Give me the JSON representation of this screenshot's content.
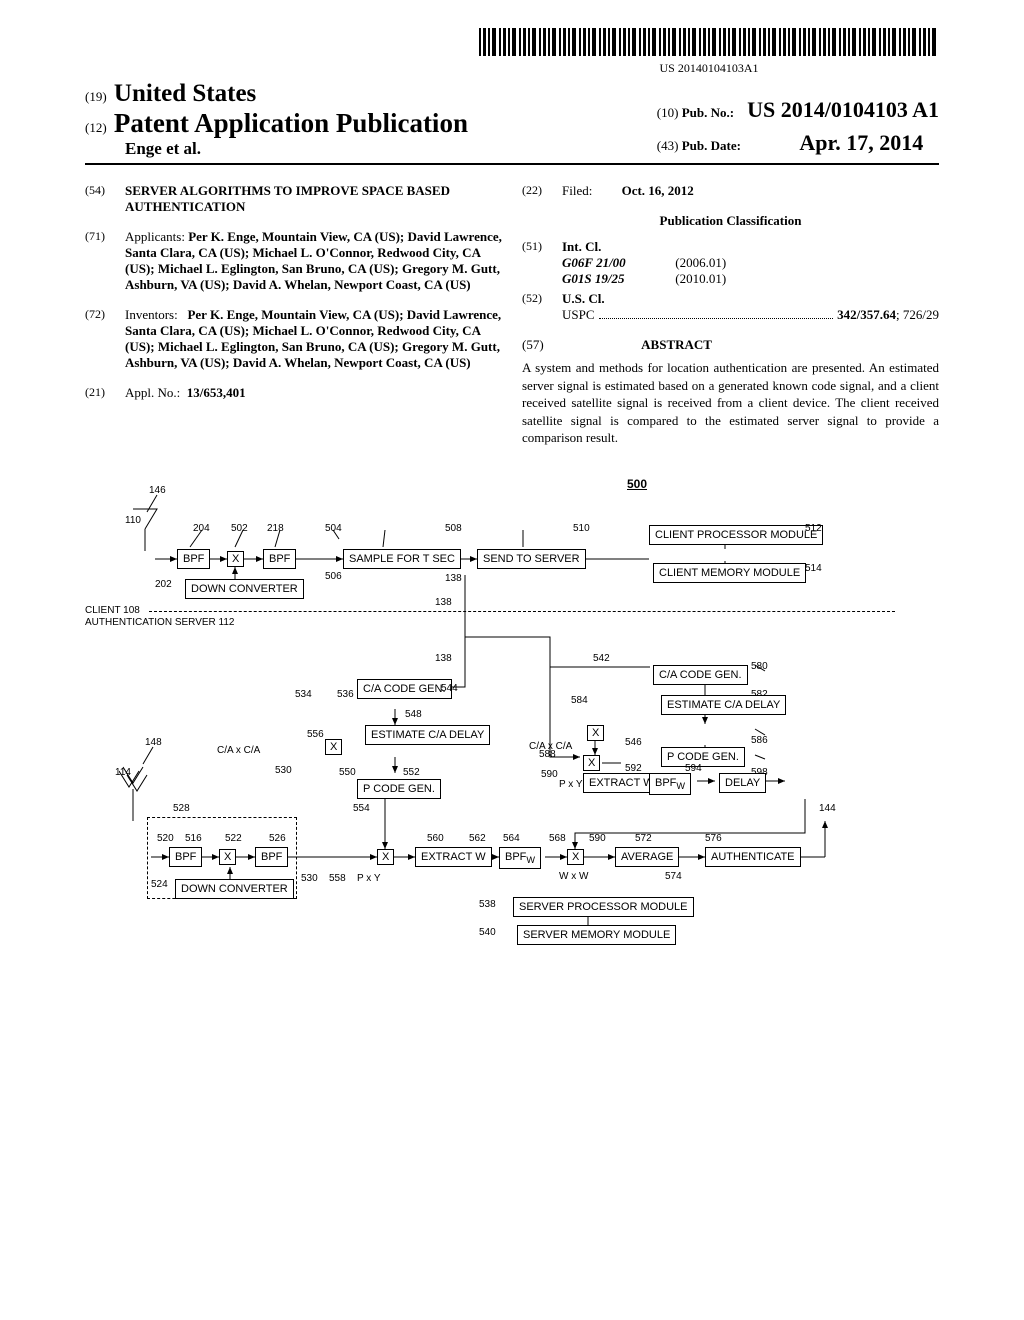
{
  "barcode_text": "US 20140104103A1",
  "header": {
    "code19": "(19)",
    "country": "United States",
    "code12": "(12)",
    "pubtype": "Patent Application Publication",
    "authors_line": "Enge et al.",
    "code10": "(10)",
    "pubno_label": "Pub. No.:",
    "pubno": "US 2014/0104103 A1",
    "code43": "(43)",
    "pubdate_label": "Pub. Date:",
    "pubdate": "Apr. 17, 2014"
  },
  "left": {
    "title_code": "(54)",
    "title": "SERVER ALGORITHMS TO IMPROVE SPACE BASED AUTHENTICATION",
    "applicants_code": "(71)",
    "applicants_label": "Applicants:",
    "applicants": "Per K. Enge, Mountain View, CA (US); David Lawrence, Santa Clara, CA (US); Michael L. O'Connor, Redwood City, CA (US); Michael L. Eglington, San Bruno, CA (US); Gregory M. Gutt, Ashburn, VA (US); David A. Whelan, Newport Coast, CA (US)",
    "inventors_code": "(72)",
    "inventors_label": "Inventors:",
    "inventors": "Per K. Enge, Mountain View, CA (US); David Lawrence, Santa Clara, CA (US); Michael L. O'Connor, Redwood City, CA (US); Michael L. Eglington, San Bruno, CA (US); Gregory M. Gutt, Ashburn, VA (US); David A. Whelan, Newport Coast, CA (US)",
    "applno_code": "(21)",
    "applno_label": "Appl. No.:",
    "applno": "13/653,401"
  },
  "right": {
    "filed_code": "(22)",
    "filed_label": "Filed:",
    "filed": "Oct. 16, 2012",
    "classification_heading": "Publication Classification",
    "intcl_code": "(51)",
    "intcl_label": "Int. Cl.",
    "intcl": [
      {
        "code": "G06F 21/00",
        "date": "(2006.01)"
      },
      {
        "code": "G01S 19/25",
        "date": "(2010.01)"
      }
    ],
    "uscl_code": "(52)",
    "uscl_label": "U.S. Cl.",
    "uspc_label": "USPC",
    "uspc_value_bold": "342/357.64",
    "uspc_value_tail": "; 726/29",
    "abstract_code": "(57)",
    "abstract_label": "ABSTRACT",
    "abstract_text": "A system and methods for location authentication are presented. An estimated server signal is estimated based on a generated known code signal, and a client received satellite signal is received from a client device. The client received satellite signal is compared to the estimated server signal to provide a comparison result."
  },
  "figure": {
    "ref500": "500",
    "client_label": "CLIENT 108",
    "server_label": "AUTHENTICATION SERVER 112",
    "boxes": {
      "bpf1": "BPF",
      "bpf2": "BPF",
      "sample": "SAMPLE FOR T SEC",
      "send": "SEND TO SERVER",
      "cproc": "CLIENT PROCESSOR MODULE",
      "cmem": "CLIENT MEMORY MODULE",
      "downconv1": "DOWN CONVERTER",
      "cacode1": "C/A CODE GEN.",
      "estca1": "ESTIMATE C/A DELAY",
      "pcode1": "P CODE GEN.",
      "cacode2": "C/A CODE GEN.",
      "estca2": "ESTIMATE C/A DELAY",
      "pcode2": "P CODE GEN.",
      "bpf3": "BPF",
      "bpf4": "BPF",
      "downconv2": "DOWN CONVERTER",
      "extractw1": "EXTRACT W",
      "extractw2": "EXTRACT W",
      "bpfw1": "BPF",
      "bpfw_sub1": "W",
      "bpfw2": "BPF",
      "bpfw_sub2": "W",
      "delay": "DELAY",
      "average": "AVERAGE",
      "auth": "AUTHENTICATE",
      "sproc": "SERVER PROCESSOR MODULE",
      "smem": "SERVER MEMORY MODULE",
      "x": "X"
    },
    "refs": {
      "146": "146",
      "110": "110",
      "204": "204",
      "502": "502",
      "218": "218",
      "504": "504",
      "506": "506",
      "508": "508",
      "510": "510",
      "512": "512",
      "514": "514",
      "202": "202",
      "138a": "138",
      "138b": "138",
      "138c": "138",
      "542": "542",
      "580": "580",
      "582": "582",
      "534": "534",
      "536": "536",
      "544": "544",
      "584": "584",
      "546": "546",
      "586": "586",
      "556": "556",
      "548": "548",
      "588": "588",
      "590a": "590",
      "592": "592",
      "594": "594",
      "598": "598",
      "148": "148",
      "114": "114",
      "528": "528",
      "530a": "530",
      "550": "550",
      "552": "552",
      "560": "560",
      "562": "562",
      "564": "564",
      "568": "568",
      "590b": "590",
      "572": "572",
      "576": "576",
      "144": "144",
      "520": "520",
      "516": "516",
      "522": "522",
      "526": "526",
      "554": "554",
      "530b": "530",
      "558": "558",
      "538": "538",
      "540": "540",
      "524": "524",
      "574": "574",
      "caxca1": "C/A x C/A",
      "caxca2": "C/A x C/A",
      "pxy1": "P x Y",
      "pxy2": "P x Y",
      "wxw": "W x W"
    }
  }
}
